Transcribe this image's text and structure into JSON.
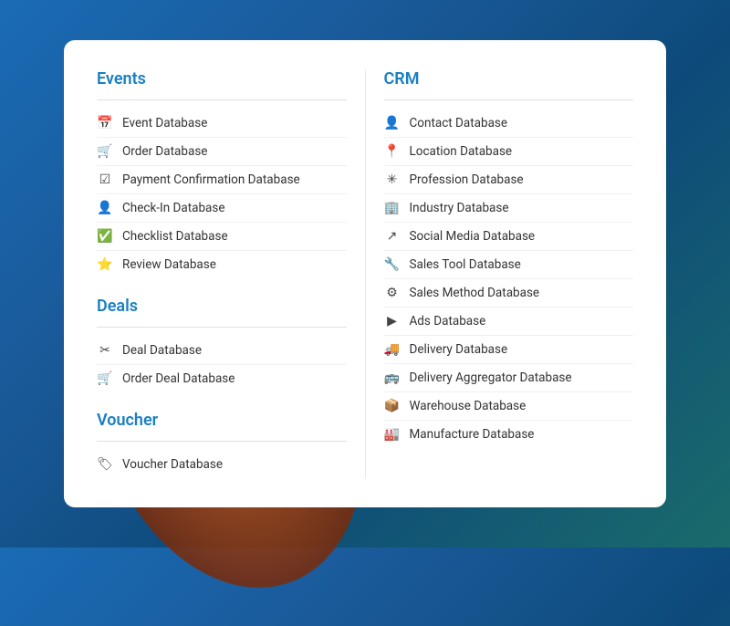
{
  "left_column": {
    "sections": [
      {
        "id": "events",
        "title": "Events",
        "items": [
          {
            "id": "event-database",
            "label": "Event Database",
            "icon": "📅"
          },
          {
            "id": "order-database",
            "label": "Order Database",
            "icon": "🛒"
          },
          {
            "id": "payment-confirmation-database",
            "label": "Payment Confirmation Database",
            "icon": "☑"
          },
          {
            "id": "check-in-database",
            "label": "Check-In Database",
            "icon": "👤"
          },
          {
            "id": "checklist-database",
            "label": "Checklist Database",
            "icon": "✅"
          },
          {
            "id": "review-database",
            "label": "Review Database",
            "icon": "⭐"
          }
        ]
      },
      {
        "id": "deals",
        "title": "Deals",
        "items": [
          {
            "id": "deal-database",
            "label": "Deal Database",
            "icon": "✂"
          },
          {
            "id": "order-deal-database",
            "label": "Order Deal Database",
            "icon": "🛒"
          }
        ]
      },
      {
        "id": "voucher",
        "title": "Voucher",
        "items": [
          {
            "id": "voucher-database",
            "label": "Voucher Database",
            "icon": "🏷"
          }
        ]
      }
    ]
  },
  "right_column": {
    "sections": [
      {
        "id": "crm",
        "title": "CRM",
        "items": [
          {
            "id": "contact-database",
            "label": "Contact Database",
            "icon": "👤"
          },
          {
            "id": "location-database",
            "label": "Location Database",
            "icon": "📍"
          },
          {
            "id": "profession-database",
            "label": "Profession Database",
            "icon": "✳"
          },
          {
            "id": "industry-database",
            "label": "Industry Database",
            "icon": "🏢"
          },
          {
            "id": "social-media-database",
            "label": "Social Media Database",
            "icon": "↗"
          },
          {
            "id": "sales-tool-database",
            "label": "Sales Tool Database",
            "icon": "🔧"
          },
          {
            "id": "sales-method-database",
            "label": "Sales Method Database",
            "icon": "⚙"
          },
          {
            "id": "ads-database",
            "label": "Ads Database",
            "icon": "▶"
          },
          {
            "id": "delivery-database",
            "label": "Delivery Database",
            "icon": "🚚"
          },
          {
            "id": "delivery-aggregator-database",
            "label": "Delivery Aggregator Database",
            "icon": "🚌"
          },
          {
            "id": "warehouse-database",
            "label": "Warehouse Database",
            "icon": "📦"
          },
          {
            "id": "manufacture-database",
            "label": "Manufacture Database",
            "icon": "🏭"
          }
        ]
      }
    ]
  }
}
